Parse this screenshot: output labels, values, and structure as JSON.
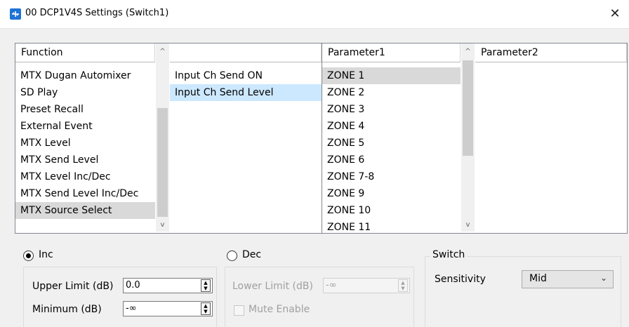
{
  "window": {
    "title": "00 DCP1V4S Settings (Switch1)",
    "close_glyph": "✕"
  },
  "function_list": {
    "header": "Function",
    "items": [
      "MTX Dugan Automixer",
      "SD Play",
      "Preset Recall",
      "External Event",
      "MTX Level",
      "MTX Send Level",
      "MTX Level Inc/Dec",
      "MTX Send Level Inc/Dec",
      "MTX Source Select"
    ],
    "selected": "MTX Source Select"
  },
  "sub_list": {
    "header": "",
    "items": [
      "Input Ch Send ON",
      "Input Ch Send Level"
    ],
    "selected": "Input Ch Send Level"
  },
  "parameter1": {
    "header": "Parameter1",
    "items": [
      "ZONE 1",
      "ZONE 2",
      "ZONE 3",
      "ZONE 4",
      "ZONE 5",
      "ZONE 6",
      "ZONE 7-8",
      "ZONE 9",
      "ZONE 10",
      "ZONE 11"
    ],
    "selected": "ZONE 1"
  },
  "parameter2": {
    "header": "Parameter2",
    "items": []
  },
  "inc": {
    "label": "Inc",
    "selected": true,
    "upper_limit_label": "Upper Limit (dB)",
    "upper_limit_value": "0.0",
    "minimum_label": "Minimum (dB)",
    "minimum_value": "-∞"
  },
  "dec": {
    "label": "Dec",
    "selected": false,
    "lower_limit_label": "Lower Limit (dB)",
    "lower_limit_value": "-∞",
    "mute_enable_label": "Mute Enable"
  },
  "switch": {
    "group_label": "Switch",
    "sensitivity_label": "Sensitivity",
    "sensitivity_value": "Mid"
  },
  "colors": {
    "selection_blue": "#cce8ff",
    "selection_gray": "#d9d9d9",
    "title_icon": "#1e73d6"
  },
  "icons": [
    "app-icon",
    "close-icon",
    "scroll-up-icon",
    "scroll-down-icon",
    "spin-up-icon",
    "spin-down-icon",
    "chevron-down-icon"
  ]
}
